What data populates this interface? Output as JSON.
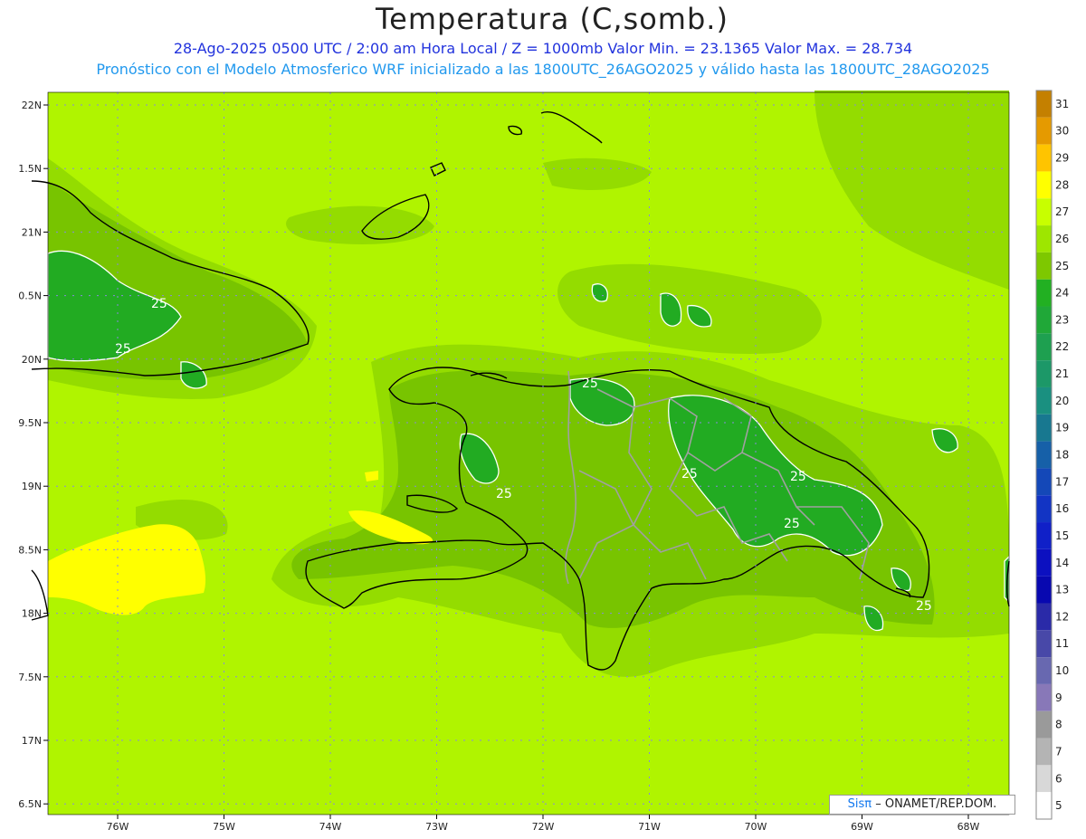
{
  "title": "Temperatura (C,somb.)",
  "subtitle_line1": "28-Ago-2025  0500 UTC / 2:00 am Hora Local / Z = 1000mb    Valor Min. = 23.1365  Valor Max. = 28.734",
  "subtitle_line2": "Pronóstico con el Modelo Atmosferico WRF inicializado a las 1800UTC_26AGO2025 y válido hasta las  1800UTC_28AGO2025",
  "lat_labels": [
    "22N",
    "1.5N",
    "21N",
    "0.5N",
    "20N",
    "9.5N",
    "19N",
    "8.5N",
    "18N",
    "7.5N",
    "17N",
    "6.5N"
  ],
  "lon_labels": [
    "76W",
    "75W",
    "74W",
    "73W",
    "72W",
    "71W",
    "70W",
    "69W",
    "68W"
  ],
  "contour_labels": [
    "25",
    "25",
    "25",
    "25",
    "25",
    "25",
    "25",
    "25"
  ],
  "colorbar": {
    "labels": [
      "31",
      "30",
      "29",
      "28",
      "27",
      "26",
      "25",
      "24",
      "23",
      "22",
      "21",
      "20",
      "19",
      "18",
      "17",
      "16",
      "15",
      "14",
      "13",
      "12",
      "11",
      "10",
      "9",
      "8",
      "7",
      "6",
      "5"
    ],
    "colors": [
      "#c48000",
      "#e59a00",
      "#ffc400",
      "#ffff00",
      "#c8ff00",
      "#9ee600",
      "#7ec800",
      "#22b022",
      "#20a838",
      "#1ea050",
      "#1c9868",
      "#1a9080",
      "#187890",
      "#1660a8",
      "#1448b8",
      "#1234c4",
      "#1020c8",
      "#0c10c0",
      "#0808b0",
      "#2a2aa8",
      "#4848a8",
      "#6868b0",
      "#8878b8",
      "#9a9a9a",
      "#b4b4b4",
      "#d8d8d8",
      "#ffffff"
    ]
  },
  "field_colors": {
    "base": "#b0f400",
    "level26": "#94dc00",
    "level25": "#78c400",
    "level24": "#22ab22",
    "level28": "#ffff00",
    "coast": "#000000",
    "border": "#a0a0a0"
  },
  "credit": {
    "brand": "Sisπ",
    "org": "ONAMET/REP.DOM."
  }
}
